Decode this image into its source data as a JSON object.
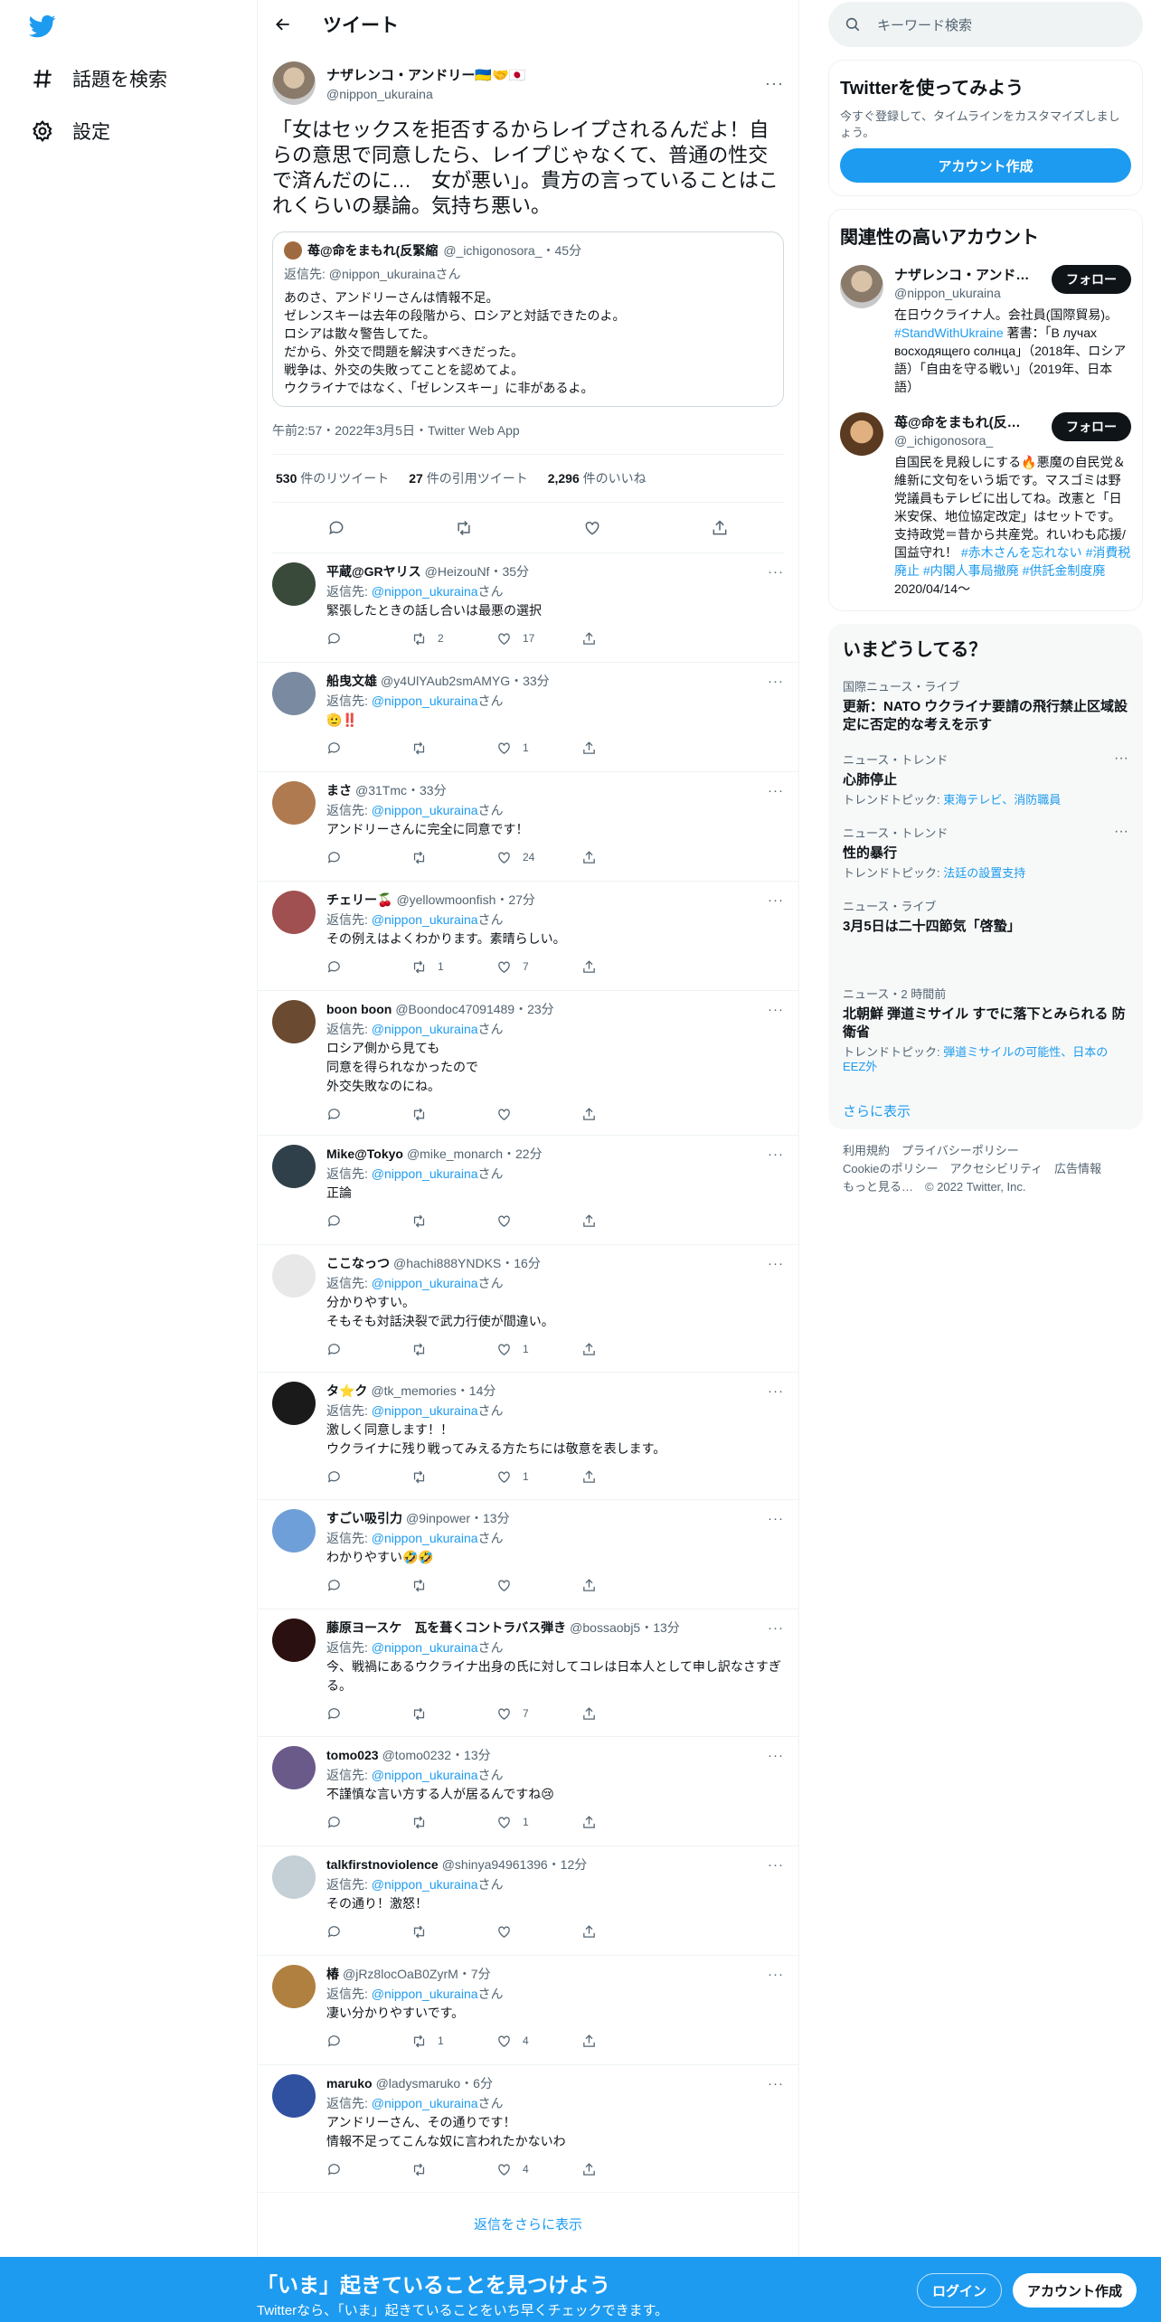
{
  "colors": {
    "brand": "#1d9bf0",
    "text": "#0f1419",
    "muted": "#536471"
  },
  "nav": {
    "explore": "話題を検索",
    "settings": "設定"
  },
  "header": {
    "title": "ツイート"
  },
  "tweet": {
    "name": "ナザレンコ・アンドリー🇺🇦🤝🇯🇵",
    "handle": "@nippon_ukuraina",
    "text": "「女はセックスを拒否するからレイプされるんだよ！自らの意思で同意したら、レイプじゃなくて、普通の性交で済んだのに…　女が悪い」。貴方の言っていることはこれくらいの暴論。気持ち悪い。",
    "time": "午前2:57・2022年3月5日・Twitter Web App",
    "quote": {
      "name": "苺@命をまもれ(反緊縮",
      "meta": "@_ichigonosora_・45分",
      "reply_to": "返信先: @nippon_ukurainaさん",
      "text": "あのさ、アンドリーさんは情報不足。\nゼレンスキーは去年の段階から、ロシアと対話できたのよ。\nロシアは散々警告してた。\nだから、外交で問題を解決すべきだった。\n戦争は、外交の失敗ってことを認めてよ。\nウクライナではなく、「ゼレンスキー」に非があるよ。"
    },
    "stats": {
      "retweets": "530",
      "retweets_label": "件のリツイート",
      "quotes": "27",
      "quotes_label": "件の引用ツイート",
      "likes": "2,296",
      "likes_label": "件のいいね"
    }
  },
  "reply_prefix": "返信先: ",
  "reply_target": "@nippon_ukuraina",
  "reply_suffix": "さん",
  "replies": [
    {
      "name": "平蔵@GRヤリス",
      "handle": "@HeizouNf・35分",
      "text": "緊張したときの話し合いは最悪の選択",
      "rt": "2",
      "like": "17",
      "avatar": "#3a4a3a"
    },
    {
      "name": "船曳文雄",
      "handle": "@y4UlYAub2smAMYG・33分",
      "text": "🫡‼️",
      "rt": "",
      "like": "1",
      "avatar": "#7a8aa0"
    },
    {
      "name": "まさ",
      "handle": "@31Tmc・33分",
      "text": "アンドリーさんに完全に同意です！",
      "rt": "",
      "like": "24",
      "avatar": "#b07a50"
    },
    {
      "name": "チェリー🍒",
      "handle": "@yellowmoonfish・27分",
      "text": "その例えはよくわかります。素晴らしい。",
      "rt": "1",
      "like": "7",
      "avatar": "#a05050"
    },
    {
      "name": "boon boon",
      "handle": "@Boondoc47091489・23分",
      "text": "ロシア側から見ても\n同意を得られなかったので\n外交失敗なのにね。",
      "rt": "",
      "like": "",
      "avatar": "#6a4a30"
    },
    {
      "name": "Mike@Tokyo",
      "handle": "@mike_monarch・22分",
      "text": "正論",
      "rt": "",
      "like": "",
      "avatar": "#30404a"
    },
    {
      "name": "ここなっつ",
      "handle": "@hachi888YNDKS・16分",
      "text": "分かりやすい。\nそもそも対話決裂で武力行使が間違い。",
      "rt": "",
      "like": "1",
      "avatar": "#e8e8e8"
    },
    {
      "name": "タ⭐ク",
      "handle": "@tk_memories・14分",
      "text": "激しく同意します！！\nウクライナに残り戦ってみえる方たちには敬意を表します。",
      "rt": "",
      "like": "1",
      "avatar": "#1a1a1a"
    },
    {
      "name": "すごい吸引力",
      "handle": "@9inpower・13分",
      "text": "わかりやすい🤣🤣",
      "rt": "",
      "like": "",
      "avatar": "#6f9fd8"
    },
    {
      "name": "藤原ヨースケ　瓦を葺くコントラバス弾き",
      "handle": "@bossaobj5・13分",
      "text": "今、戦禍にあるウクライナ出身の氏に対してコレは日本人として申し訳なさすぎる。",
      "rt": "",
      "like": "7",
      "avatar": "#2a1010"
    },
    {
      "name": "tomo023",
      "handle": "@tomo0232・13分",
      "text": "不謹慎な言い方する人が居るんですね😢",
      "rt": "",
      "like": "1",
      "avatar": "#6a5a8a"
    },
    {
      "name": "talkfirstnoviolence",
      "handle": "@shinya94961396・12分",
      "text": "その通り！激怒！",
      "rt": "",
      "like": "",
      "avatar": "#c4cfd6"
    },
    {
      "name": "椿",
      "handle": "@jRz8locOaB0ZyrM・7分",
      "text": "凄い分かりやすいです。",
      "rt": "1",
      "like": "4",
      "avatar": "#b08040"
    },
    {
      "name": "maruko",
      "handle": "@ladysmaruko・6分",
      "text": "アンドリーさん、その通りです！\n情報不足ってこんな奴に言われたかないわ",
      "rt": "",
      "like": "4",
      "avatar": "#3050a0"
    }
  ],
  "show_more_replies": "返信をさらに表示",
  "search": {
    "placeholder": "キーワード検索"
  },
  "signup_card": {
    "title": "Twitterを使ってみよう",
    "sub": "今すぐ登録して、タイムラインをカスタマイズしましょう。",
    "button": "アカウント作成"
  },
  "related": {
    "title": "関連性の高いアカウント",
    "follow": "フォロー",
    "accounts": [
      {
        "name": "ナザレンコ・アンドリー🇺🇦🤝🇯🇵",
        "handle": "@nippon_ukuraina",
        "bio_pre": "在日ウクライナ人。会社員(国際貿易)。 ",
        "bio_tag": "#StandWithUkraine",
        "bio_post": " 著書：「В лучах восходящего солнца」（2018年、ロシア語）「自由を守る戦い」（2019年、日本語）"
      },
      {
        "name": "苺@命をまもれ(反緊縮",
        "handle": "@_ichigonosora_",
        "bio_pre": "自国民を見殺しにする🔥悪魔の自民党＆維新に文句をいう垢です。マスゴミは野党議員もテレビに出してね。改憲と「日米安保、地位協定改定」はセットです。支持政党＝昔から共産党。れいわも応援/国益守れ！ ",
        "bio_tag": "#赤木さんを忘れない #消費税廃止 #内閣人事局撤廃 #供託金制度廃",
        "bio_post": " 2020/04/14～"
      }
    ]
  },
  "trends": {
    "title": "いまどうしてる？",
    "items": [
      {
        "cat": "国際ニュース・ライブ",
        "title": "更新：NATO ウクライナ要請の飛行禁止区域設定に否定的な考えを示す",
        "sub_pre": "",
        "sub_link": ""
      },
      {
        "cat": "ニュース・トレンド",
        "title": "心肺停止",
        "sub_pre": "トレンドトピック: ",
        "sub_link": "東海テレビ、消防職員"
      },
      {
        "cat": "ニュース・トレンド",
        "title": "性的暴行",
        "sub_pre": "トレンドトピック: ",
        "sub_link": "法廷の設置支持"
      },
      {
        "cat": "ニュース・ライブ",
        "title": "3月5日は二十四節気「啓蟄」",
        "sub_pre": "",
        "sub_link": ""
      },
      {
        "cat": "ニュース・2 時間前",
        "title": "北朝鮮 弾道ミサイル すでに落下とみられる 防衛省",
        "sub_pre": "トレンドトピック: ",
        "sub_link": "弾道ミサイルの可能性、日本のEEZ外"
      }
    ],
    "more": "さらに表示"
  },
  "footer": {
    "l1": "利用規約　プライバシーポリシー",
    "l2": "Cookieのポリシー　アクセシビリティ　広告情報",
    "l3": "もっと見る…　© 2022 Twitter, Inc."
  },
  "bottombar": {
    "title": "「いま」起きていることを見つけよう",
    "sub": "Twitterなら、「いま」起きていることをいち早くチェックできます。",
    "login": "ログイン",
    "signup": "アカウント作成"
  }
}
